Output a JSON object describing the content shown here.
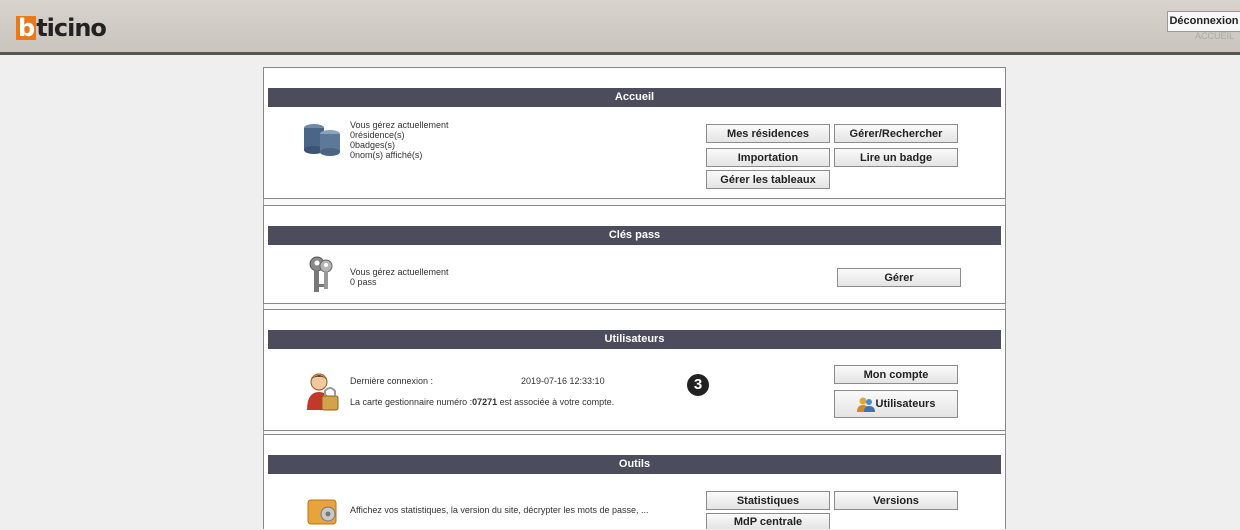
{
  "header": {
    "logo_text": "bticino",
    "logout_label": "Déconnexion",
    "user_label": "ACCUEIL"
  },
  "accueil": {
    "title": "Accueil",
    "intro": "Vous gérez actuellement",
    "residences": "0résidence(s)",
    "badges": "0badges(s)",
    "names": "0nom(s) affiché(s)",
    "btn_residences": "Mes résidences",
    "btn_search": "Gérer/Rechercher",
    "btn_import": "Importation",
    "btn_read_badge": "Lire un badge",
    "btn_tables": "Gérer les tableaux"
  },
  "cles": {
    "title": "Clés pass",
    "intro": "Vous gérez actuellement",
    "count": "0 pass",
    "btn_manage": "Gérer"
  },
  "users": {
    "title": "Utilisateurs",
    "last_login_label": "Dernière connexion :",
    "last_login_value": "2019-07-16 12:33:10",
    "card_prefix": "La carte gestionnaire numéro :",
    "card_number": "07271",
    "card_suffix": " est associée à votre compte.",
    "btn_account": "Mon compte",
    "btn_users": "Utilisateurs",
    "callout": "3"
  },
  "tools": {
    "title": "Outils",
    "text": "Affichez vos statistiques, la version du site, décrypter les mots de passe, ...",
    "btn_stats": "Statistiques",
    "btn_versions": "Versions",
    "btn_mdp": "MdP centrale"
  },
  "colors": {
    "panel_header": "#4d4c5d",
    "logo_accent": "#e87a1d"
  }
}
